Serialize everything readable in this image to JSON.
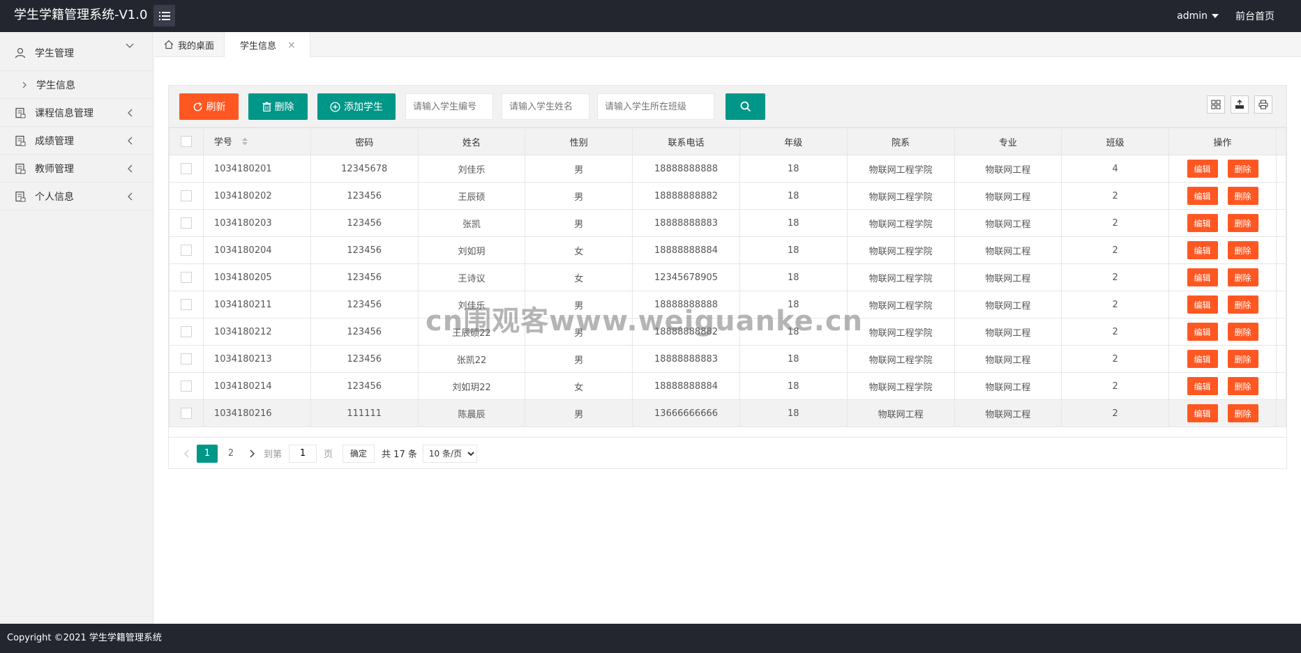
{
  "header": {
    "logo": "学生学籍管理系统-V1.0",
    "user": "admin",
    "home_link": "前台首页"
  },
  "sidebar": {
    "items": [
      {
        "label": "学生管理",
        "icon": "user-icon",
        "expanded": true,
        "children": [
          {
            "label": "学生信息"
          }
        ]
      },
      {
        "label": "课程信息管理",
        "icon": "course-icon"
      },
      {
        "label": "成绩管理",
        "icon": "grade-icon"
      },
      {
        "label": "教师管理",
        "icon": "teacher-icon"
      },
      {
        "label": "个人信息",
        "icon": "profile-icon"
      }
    ]
  },
  "tabs": [
    {
      "label": "我的桌面",
      "icon": "home-icon"
    },
    {
      "label": "学生信息",
      "active": true
    }
  ],
  "toolbar": {
    "refresh_label": "刷新",
    "delete_label": "删除",
    "add_label": "添加学生",
    "search_id_placeholder": "请输入学生编号",
    "search_name_placeholder": "请输入学生姓名",
    "search_class_placeholder": "请输入学生所在班级"
  },
  "table": {
    "columns": [
      "学号",
      "密码",
      "姓名",
      "性别",
      "联系电话",
      "年级",
      "院系",
      "专业",
      "班级",
      "操作"
    ],
    "edit_label": "编辑",
    "delete_label": "删除",
    "rows": [
      [
        "1034180201",
        "12345678",
        "刘佳乐",
        "男",
        "18888888888",
        "18",
        "物联网工程学院",
        "物联网工程",
        "4"
      ],
      [
        "1034180202",
        "123456",
        "王辰硕",
        "男",
        "18888888882",
        "18",
        "物联网工程学院",
        "物联网工程",
        "2"
      ],
      [
        "1034180203",
        "123456",
        "张凯",
        "男",
        "18888888883",
        "18",
        "物联网工程学院",
        "物联网工程",
        "2"
      ],
      [
        "1034180204",
        "123456",
        "刘如玥",
        "女",
        "18888888884",
        "18",
        "物联网工程学院",
        "物联网工程",
        "2"
      ],
      [
        "1034180205",
        "123456",
        "王诗议",
        "女",
        "12345678905",
        "18",
        "物联网工程学院",
        "物联网工程",
        "2"
      ],
      [
        "1034180211",
        "123456",
        "刘佳乐",
        "男",
        "18888888888",
        "18",
        "物联网工程学院",
        "物联网工程",
        "2"
      ],
      [
        "1034180212",
        "123456",
        "王辰硕22",
        "男",
        "18888888882",
        "18",
        "物联网工程学院",
        "物联网工程",
        "2"
      ],
      [
        "1034180213",
        "123456",
        "张凯22",
        "男",
        "18888888883",
        "18",
        "物联网工程学院",
        "物联网工程",
        "2"
      ],
      [
        "1034180214",
        "123456",
        "刘如玥22",
        "女",
        "18888888884",
        "18",
        "物联网工程学院",
        "物联网工程",
        "2"
      ],
      [
        "1034180216",
        "111111",
        "陈晨辰",
        "男",
        "13666666666",
        "18",
        "物联网工程",
        "物联网工程",
        "2"
      ]
    ]
  },
  "pagination": {
    "pages": [
      "1",
      "2"
    ],
    "current": "1",
    "goto_label": "到第",
    "goto_value": "1",
    "page_unit": "页",
    "confirm_label": "确定",
    "total_label": "共 17 条",
    "page_size": "10 条/页"
  },
  "watermark": "cn围观客www.weiguanke.cn",
  "footer": {
    "copyright": "Copyright ©2021 学生学籍管理系统"
  },
  "colors": {
    "primary": "#009688",
    "danger": "#ff5722",
    "header_bg": "#23262e"
  }
}
